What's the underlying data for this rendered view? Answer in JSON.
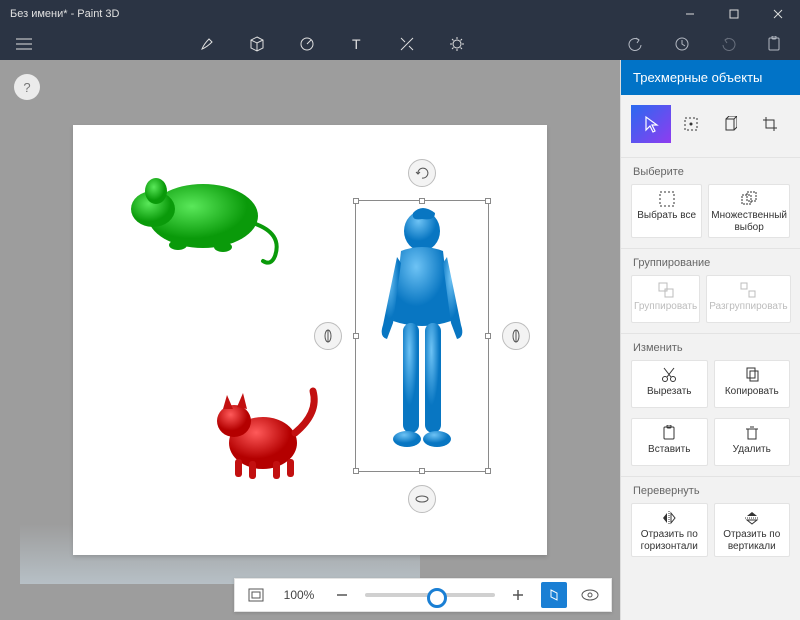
{
  "window": {
    "title": "Без имени* - Paint 3D"
  },
  "titlebar": {
    "minimize": "–",
    "maximize": "□",
    "close": "✕"
  },
  "toolbar": {
    "tools": [
      {
        "name": "brush-icon"
      },
      {
        "name": "3d-shapes-icon"
      },
      {
        "name": "stickers-icon"
      },
      {
        "name": "text-icon"
      },
      {
        "name": "effects-icon"
      },
      {
        "name": "canvas-icon"
      }
    ],
    "history": [
      {
        "name": "undo-icon"
      },
      {
        "name": "history-icon"
      },
      {
        "name": "redo-icon"
      },
      {
        "name": "paste-icon"
      }
    ]
  },
  "help": {
    "symbol": "?"
  },
  "sidebar": {
    "title": "Трехмерные объекты",
    "modes": [
      {
        "name": "select-mode",
        "active": true
      },
      {
        "name": "magic-select-mode",
        "active": false
      },
      {
        "name": "3d-view-mode",
        "active": false
      },
      {
        "name": "crop-mode",
        "active": false
      }
    ],
    "sections": {
      "select": {
        "label": "Выберите",
        "buttons": [
          {
            "name": "select-all-button",
            "label": "Выбрать все",
            "icon": "select-all"
          },
          {
            "name": "multi-select-button",
            "label": "Множественный выбор",
            "icon": "multi-select"
          }
        ]
      },
      "group": {
        "label": "Группирование",
        "buttons": [
          {
            "name": "group-button",
            "label": "Группировать",
            "icon": "group",
            "disabled": true
          },
          {
            "name": "ungroup-button",
            "label": "Разгруппировать",
            "icon": "ungroup",
            "disabled": true
          }
        ]
      },
      "edit": {
        "label": "Изменить",
        "buttons": [
          {
            "name": "cut-button",
            "label": "Вырезать",
            "icon": "cut"
          },
          {
            "name": "copy-button",
            "label": "Копировать",
            "icon": "copy"
          },
          {
            "name": "paste-button",
            "label": "Вставить",
            "icon": "paste"
          },
          {
            "name": "delete-button",
            "label": "Удалить",
            "icon": "delete"
          }
        ]
      },
      "flip": {
        "label": "Перевернуть",
        "buttons": [
          {
            "name": "flip-horizontal-button",
            "label": "Отразить по горизонтали",
            "icon": "flip-h"
          },
          {
            "name": "flip-vertical-button",
            "label": "Отразить по вертикали",
            "icon": "flip-v"
          }
        ]
      }
    }
  },
  "zoom": {
    "percent": "100%"
  },
  "canvas_objects": [
    {
      "name": "green-mouse-3d",
      "color": "#19c319"
    },
    {
      "name": "red-cat-3d",
      "color": "#e62020"
    },
    {
      "name": "blue-person-3d",
      "color": "#2a9ee8",
      "selected": true
    }
  ]
}
